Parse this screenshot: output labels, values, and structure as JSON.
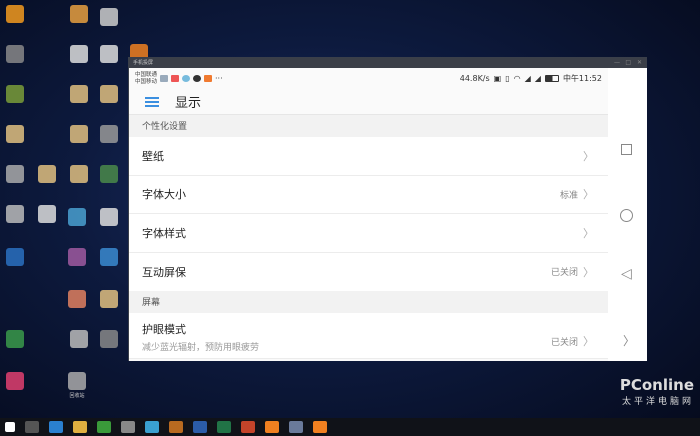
{
  "window": {
    "title": "手机投屏"
  },
  "status": {
    "carrier1": "中国联通",
    "carrier2": "中国移动",
    "more": "···",
    "speed": "44.8K/s",
    "time": "中午11:52"
  },
  "appbar": {
    "title": "显示"
  },
  "sections": [
    {
      "header": "个性化设置",
      "rows": [
        {
          "label": "壁纸",
          "value": ""
        },
        {
          "label": "字体大小",
          "value": "标准"
        },
        {
          "label": "字体样式",
          "value": ""
        },
        {
          "label": "互动屏保",
          "value": "已关闭"
        }
      ]
    },
    {
      "header": "屏幕",
      "rows": [
        {
          "label": "护眼模式",
          "sub": "减少蓝光辐射，预防用眼疲劳",
          "value": "已关闭"
        }
      ]
    }
  ],
  "desktop": {
    "recycle_bin": "回收站"
  },
  "watermark": {
    "brand": "PConline",
    "cn": "太平洋电脑网"
  },
  "colors": {
    "accent": "#3b8fe0"
  }
}
